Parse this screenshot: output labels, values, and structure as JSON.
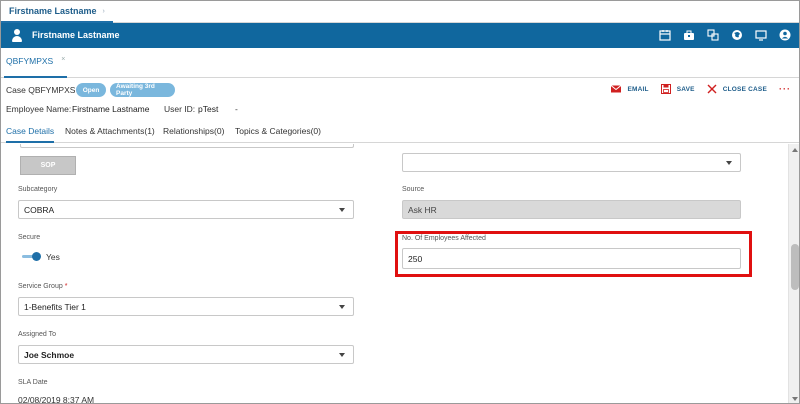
{
  "top_tab": {
    "label": "Firstname Lastname",
    "chevron": "›"
  },
  "header": {
    "user_icon": "user-icon",
    "title": "Firstname Lastname",
    "icons": [
      "calendar-icon",
      "briefcase-icon",
      "copy-icon",
      "globe-icon",
      "monitor-icon",
      "account-icon"
    ]
  },
  "case_tab": {
    "label": "QBFYMPXS",
    "close": "×"
  },
  "case_info": {
    "label": "Case QBFYMPXS",
    "badges": [
      "Open",
      "Awaiting 3rd Party"
    ],
    "actions": {
      "email": "EMAIL",
      "save": "SAVE",
      "close_case": "CLOSE CASE",
      "more": "···"
    }
  },
  "employee_row": {
    "name_label": "Employee Name:",
    "name_value": "Firstname Lastname",
    "user_id_label": "User ID:",
    "user_id_value": "pTest",
    "extra": "-"
  },
  "detail_tabs": [
    "Case Details",
    "Notes & Attachments(1)",
    "Relationships(0)",
    "Topics & Categories(0)"
  ],
  "form": {
    "sop_button": "SOP",
    "subcategory": {
      "label": "Subcategory",
      "value": "COBRA"
    },
    "source": {
      "label": "Source",
      "value": "Ask HR"
    },
    "secure": {
      "label": "Secure",
      "value": "Yes",
      "on": true
    },
    "employees_affected": {
      "label": "No. Of Employees Affected",
      "value": "250"
    },
    "service_group": {
      "label": "Service Group",
      "required": "*",
      "value": "1-Benefits Tier 1"
    },
    "assigned_to": {
      "label": "Assigned To",
      "value": "Joe Schmoe"
    },
    "sla_date": {
      "label": "SLA Date",
      "value": "02/08/2019 8:37 AM"
    },
    "right_top_select": {
      "value": ""
    }
  },
  "colors": {
    "primary": "#10679e",
    "accent": "#1e6fa8",
    "highlight": "#e01010",
    "badge": "#7ab7dd"
  }
}
